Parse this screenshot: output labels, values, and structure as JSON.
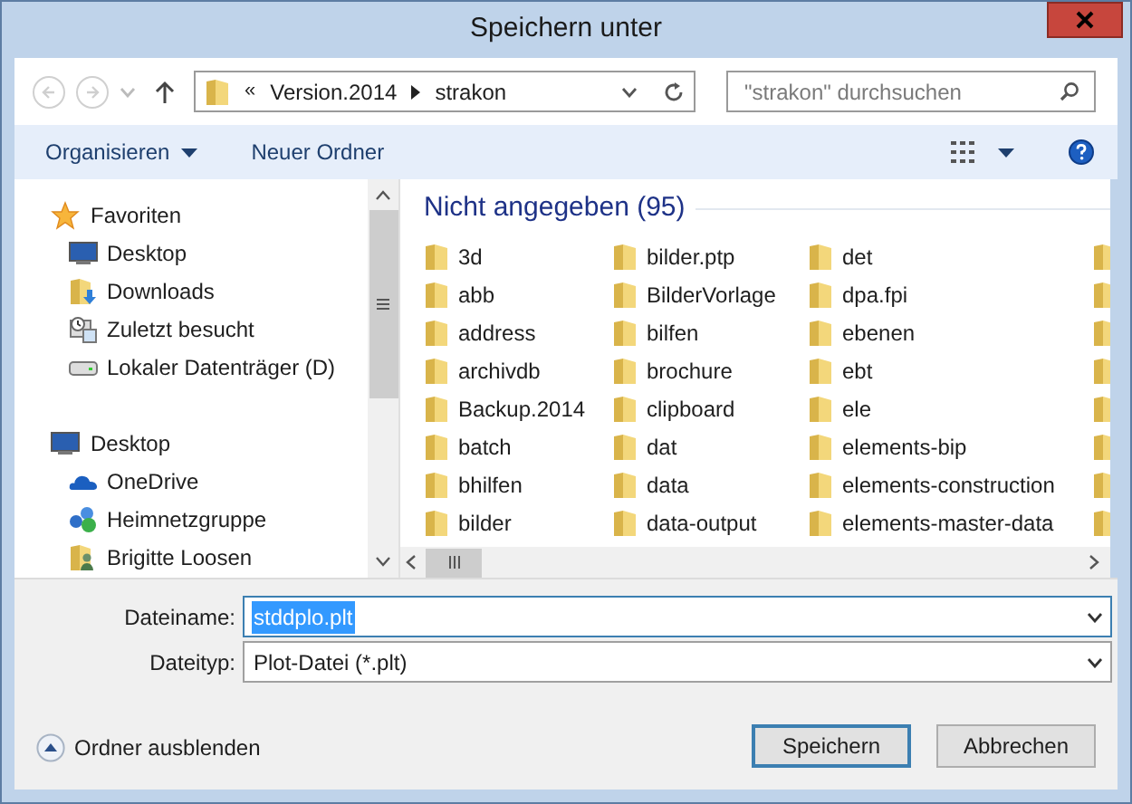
{
  "window": {
    "title": "Speichern unter"
  },
  "nav": {
    "back_disabled": true,
    "forward_disabled": true
  },
  "address": {
    "overflow": "«",
    "segments": [
      "Version.2014",
      "strakon"
    ]
  },
  "search": {
    "placeholder": "\"strakon\" durchsuchen"
  },
  "toolbar": {
    "organize": "Organisieren",
    "new_folder": "Neuer Ordner"
  },
  "sidebar": {
    "sections": [
      {
        "label": "Favoriten",
        "kind": "star",
        "children": [
          {
            "label": "Desktop",
            "kind": "desktop"
          },
          {
            "label": "Downloads",
            "kind": "downloads"
          },
          {
            "label": "Zuletzt besucht",
            "kind": "recent"
          },
          {
            "label": "Lokaler Datenträger (D)",
            "kind": "drive"
          }
        ]
      },
      {
        "label": "Desktop",
        "kind": "desktop",
        "children": [
          {
            "label": "OneDrive",
            "kind": "cloud"
          },
          {
            "label": "Heimnetzgruppe",
            "kind": "homegroup"
          },
          {
            "label": "Brigitte Loosen",
            "kind": "user"
          }
        ]
      }
    ]
  },
  "group": {
    "title": "Nicht angegeben (95)"
  },
  "files": [
    [
      "3d",
      "abb",
      "address",
      "archivdb",
      "Backup.2014",
      "batch",
      "bhilfen",
      "bilder"
    ],
    [
      "bilder.ptp",
      "BilderVorlage",
      "bilfen",
      "brochure",
      "clipboard",
      "dat",
      "data",
      "data-output"
    ],
    [
      "det",
      "dpa.fpi",
      "ebenen",
      "ebt",
      "ele",
      "elements-bip",
      "elements-construction",
      "elements-master-data"
    ]
  ],
  "fields": [
    {
      "label": "Dateiname:",
      "value": "stddplo.plt",
      "selected": true
    },
    {
      "label": "Dateityp:",
      "value": "Plot-Datei (*.plt)",
      "selected": false
    }
  ],
  "toggle": {
    "label": "Ordner ausblenden"
  },
  "buttons": [
    {
      "label": "Speichern",
      "default": true
    },
    {
      "label": "Abbrechen",
      "default": false
    }
  ]
}
